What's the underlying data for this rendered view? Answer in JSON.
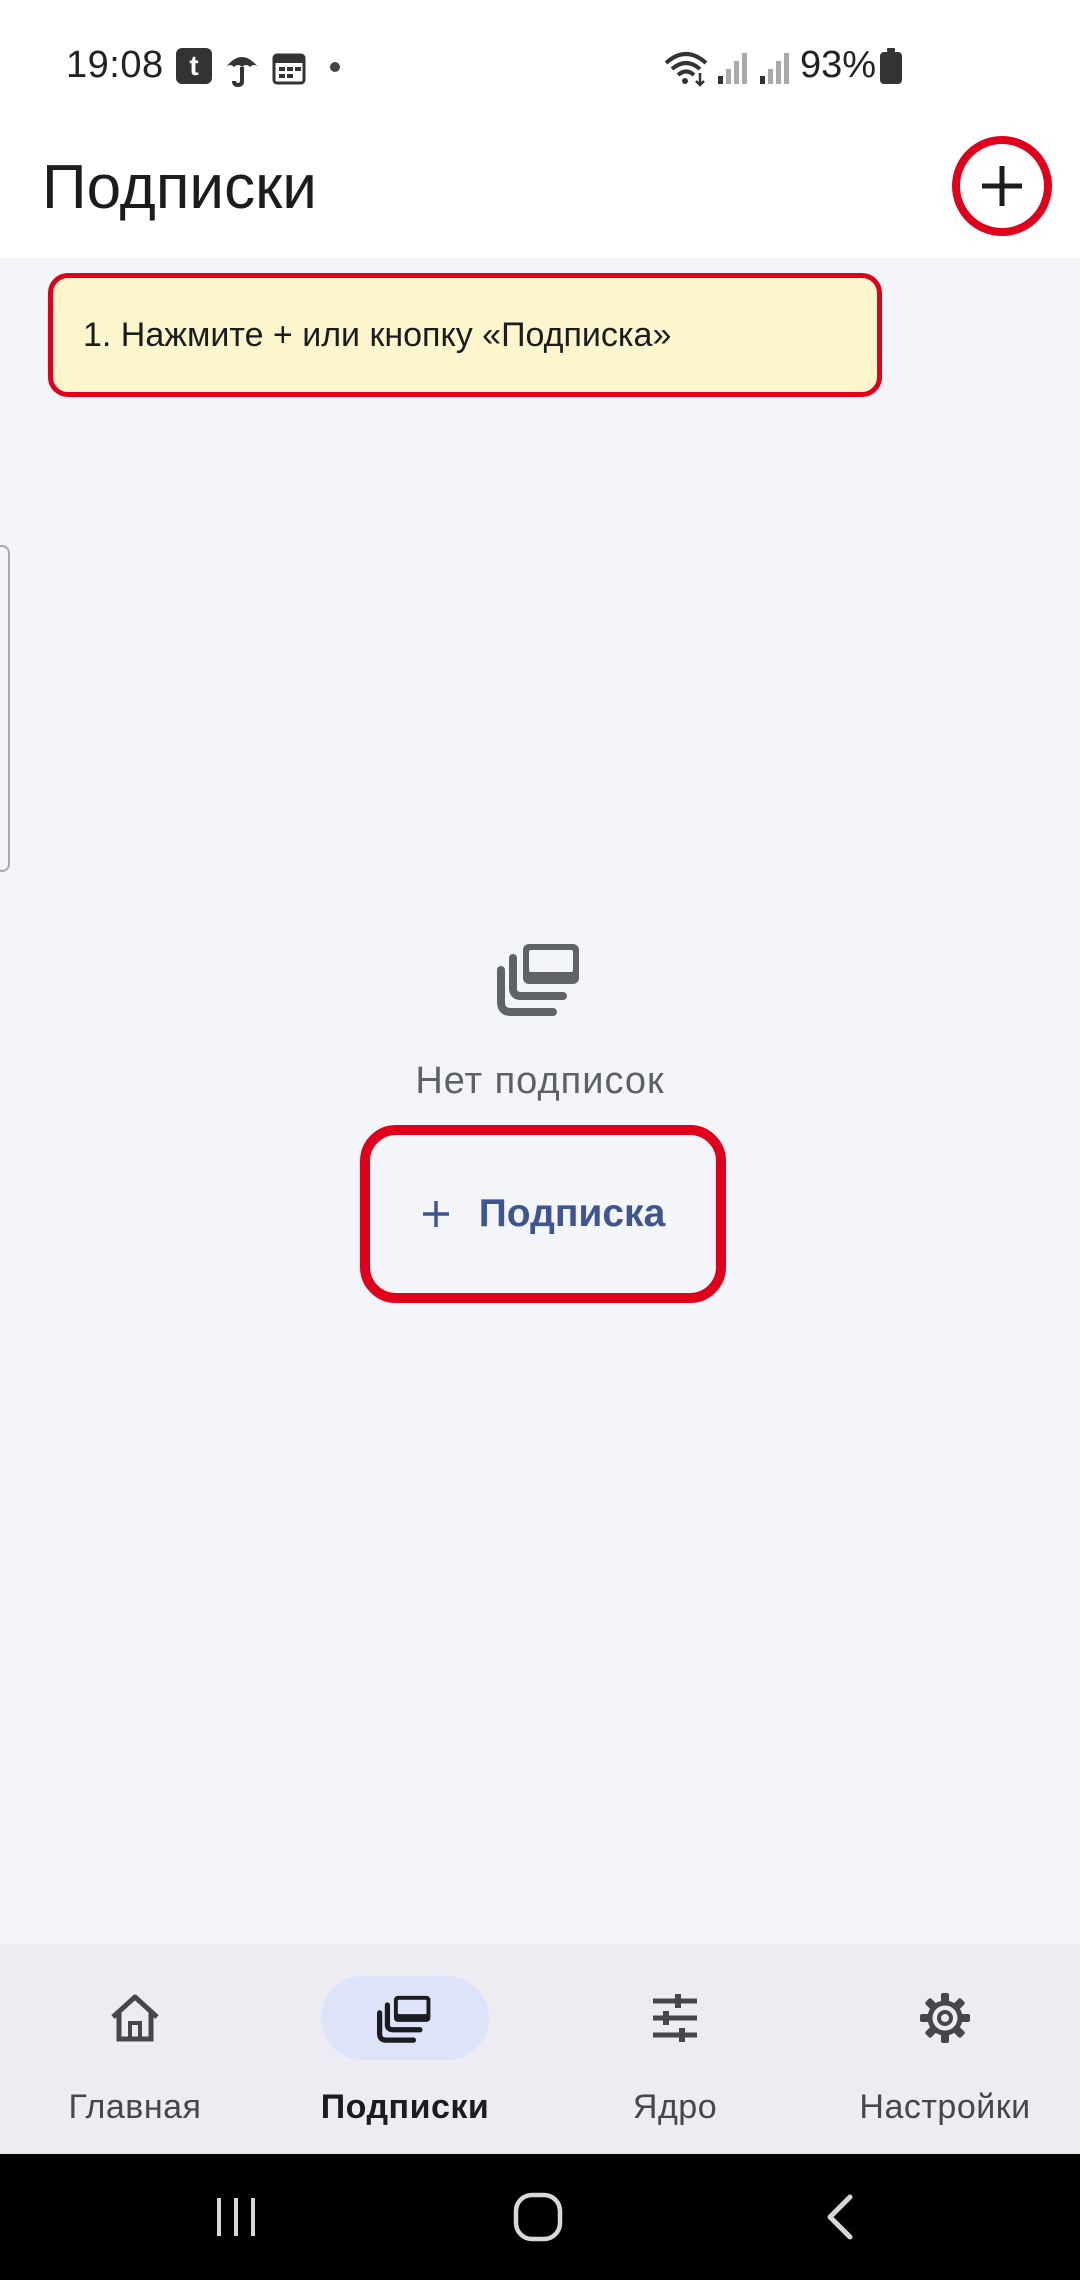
{
  "status_bar": {
    "time": "19:08",
    "notif_t": "t",
    "battery": "93%",
    "icons": [
      "tele2-icon",
      "umbrella-icon",
      "calendar-icon",
      "dot-icon",
      "wifi-icon",
      "signal-icon",
      "signal-icon",
      "battery-charging-icon"
    ]
  },
  "app_bar": {
    "title": "Подписки",
    "add_icon": "plus-icon"
  },
  "hint": {
    "text": "1. Нажмите + или кнопку «Подписка»"
  },
  "empty_state": {
    "icon": "subscriptions-stack-icon",
    "text": "Нет подписок",
    "button_icon": "plus-icon",
    "button_label": "Подписка"
  },
  "bottom_nav": {
    "items": [
      {
        "label": "Главная",
        "icon": "home-icon",
        "active": false
      },
      {
        "label": "Подписки",
        "icon": "subscriptions-icon",
        "active": true
      },
      {
        "label": "Ядро",
        "icon": "tune-icon",
        "active": false
      },
      {
        "label": "Настройки",
        "icon": "gear-icon",
        "active": false
      }
    ]
  },
  "system_nav": {
    "buttons": [
      "recent-apps-icon",
      "home-circle-icon",
      "back-icon"
    ]
  },
  "colors": {
    "highlight": "#e0001b",
    "hint_bg": "#fdf5cb",
    "accent": "#3e5592",
    "nav_active_bg": "#dde3f9",
    "page_bg": "#f4f5f8"
  }
}
